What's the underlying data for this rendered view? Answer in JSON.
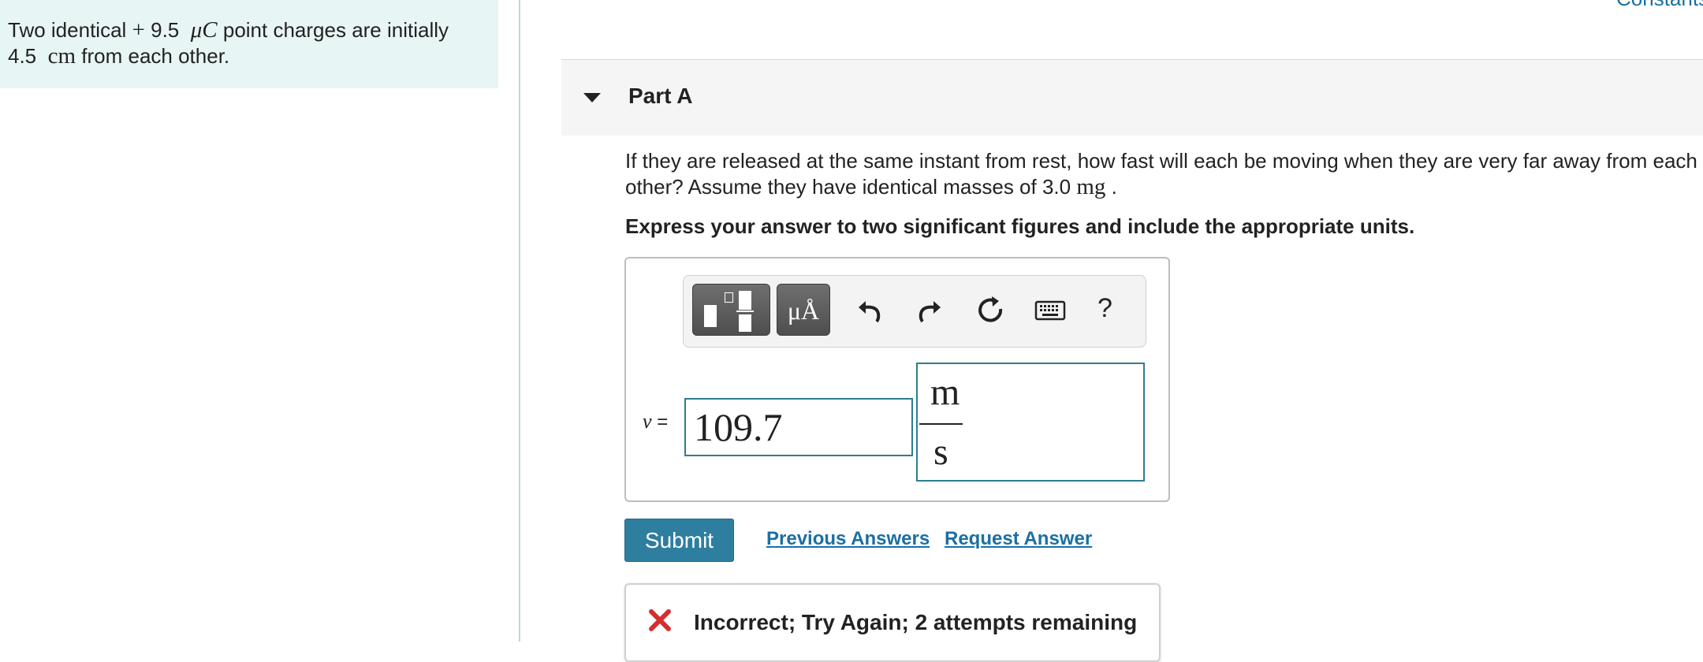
{
  "problem": {
    "text_before": "Two identical ",
    "charge_sign": "+",
    "charge_value": "9.5",
    "charge_unit": "μC",
    "text_middle": " point charges are initially",
    "distance_value": "4.5",
    "distance_unit": "cm",
    "text_after": " from each other."
  },
  "header": {
    "constants_link": "Constants"
  },
  "part": {
    "title": "Part A",
    "question_line1": "If they are released at the same instant from rest, how fast will each be moving when they are very far away from each",
    "question_line2_before": "other? Assume they have identical masses of 3.0 ",
    "mass_unit": "mg",
    "question_line2_after": " .",
    "instruction": "Express your answer to two significant figures and include the appropriate units."
  },
  "toolbar": {
    "units_label": "μÅ",
    "help_label": "?"
  },
  "answer": {
    "variable": "v",
    "equals": " =",
    "value": "109.7",
    "unit_numerator": "m",
    "unit_denominator": "s"
  },
  "actions": {
    "submit_label": "Submit",
    "previous_answers_label": "Previous Answers",
    "request_answer_label": "Request Answer"
  },
  "feedback": {
    "message": "Incorrect; Try Again; 2 attempts remaining",
    "status_color": "#d32f2f"
  },
  "colors": {
    "accent": "#2e7ea0",
    "link": "#1b6fa3",
    "problem_bg": "#e8f5f5"
  }
}
